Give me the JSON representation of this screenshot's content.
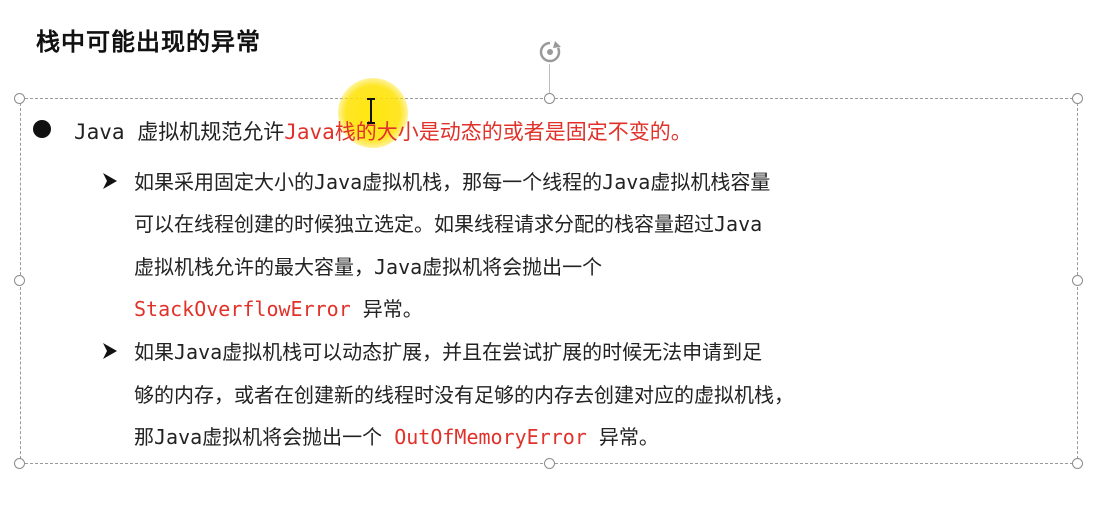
{
  "slide": {
    "title": "栈中可能出现的异常"
  },
  "bullet": {
    "text_plain": "Java 虚拟机规范允许",
    "text_red": "Java栈的大小是动态的或者是固定不变的。"
  },
  "sub_items": [
    {
      "lines": [
        {
          "plain": "如果采用固定大小的Java虚拟机栈，那每一个线程的Java虚拟机栈容量"
        },
        {
          "plain": "可以在线程创建的时候独立选定。如果线程请求分配的栈容量超过Java"
        },
        {
          "plain": "虚拟机栈允许的最大容量，Java虚拟机将会抛出一个"
        },
        {
          "red": "StackOverflowError",
          "after": " 异常。"
        }
      ]
    },
    {
      "lines": [
        {
          "plain": "如果Java虚拟机栈可以动态扩展，并且在尝试扩展的时候无法申请到足"
        },
        {
          "plain": "够的内存，或者在创建新的线程时没有足够的内存去创建对应的虚拟机栈，"
        },
        {
          "plain": "那Java虚拟机将会抛出一个 ",
          "red": "OutOfMemoryError",
          "after": " 异常。"
        }
      ]
    }
  ],
  "colors": {
    "highlight_red": "#e0322a",
    "cursor_highlight": "#ffe100",
    "selection_border": "#9a9a9a"
  },
  "icons": {
    "rotate": "rotate-handle-icon",
    "arrow": "arrowhead-bullet-icon",
    "cursor": "text-cursor-icon"
  }
}
